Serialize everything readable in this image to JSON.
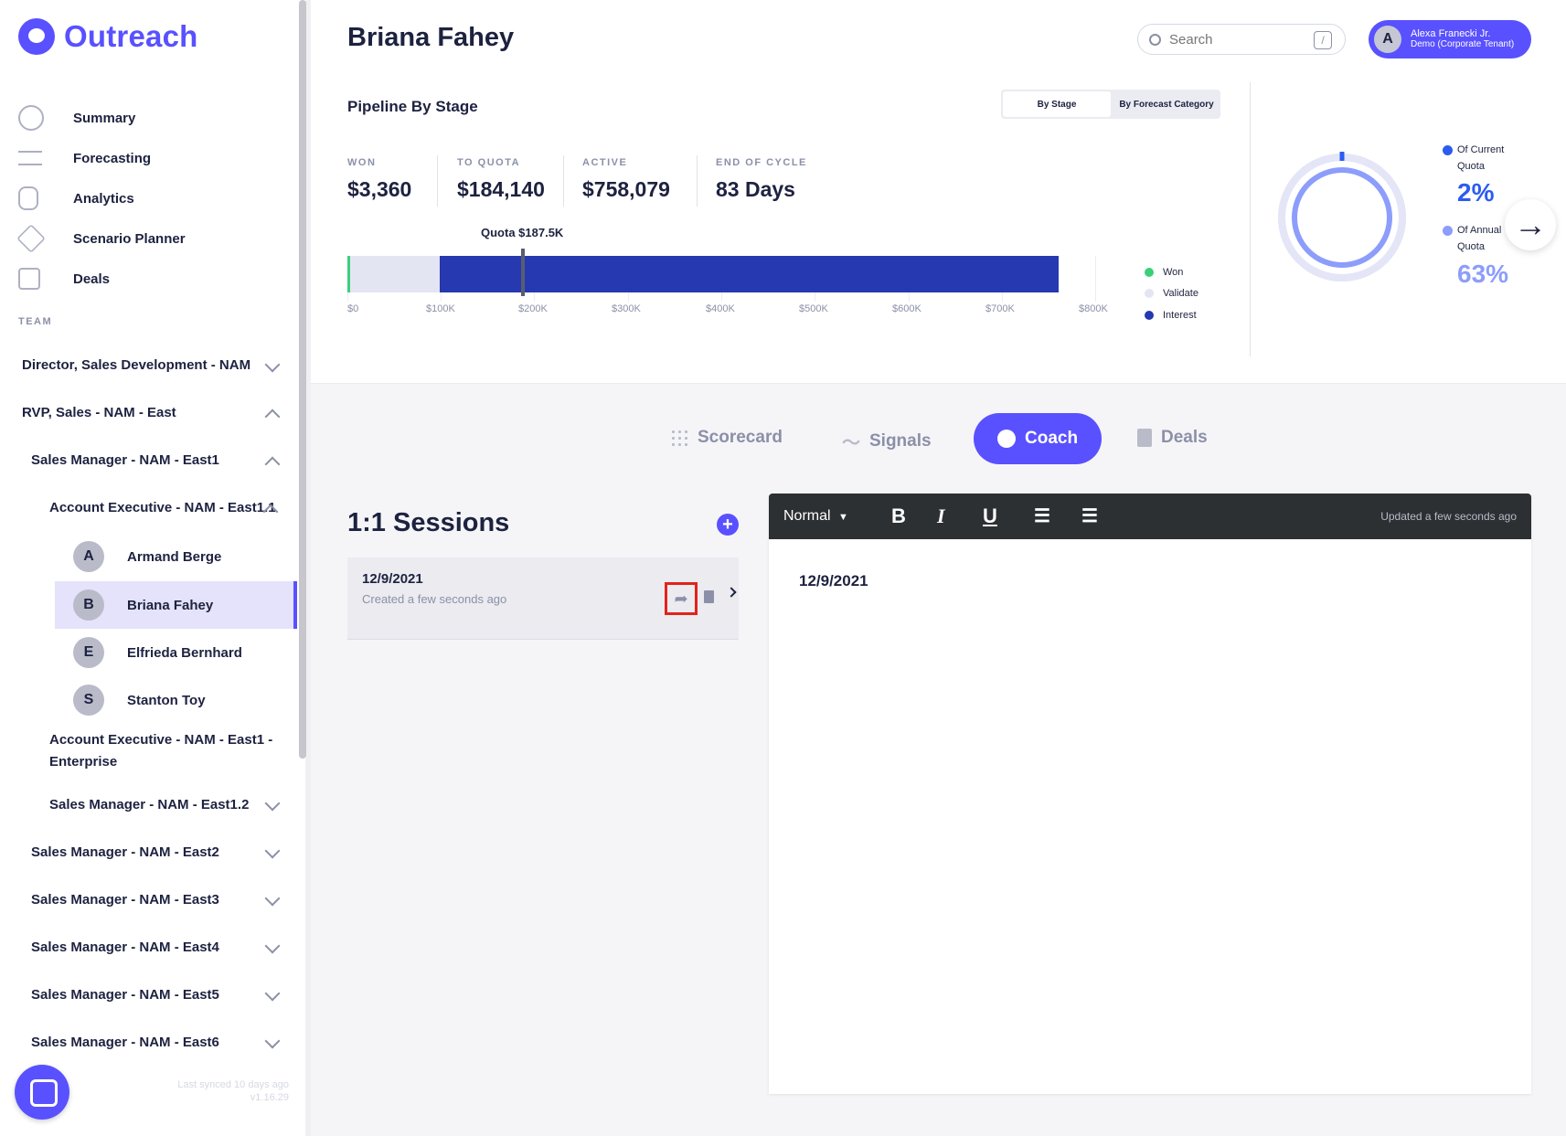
{
  "app": {
    "brand": "Outreach",
    "accent": "#5951ff"
  },
  "sidebar": {
    "nav": [
      {
        "label": "Summary",
        "icon": "circle-icon"
      },
      {
        "label": "Forecasting",
        "icon": "lines-icon"
      },
      {
        "label": "Analytics",
        "icon": "analytics-icon"
      },
      {
        "label": "Scenario Planner",
        "icon": "triangle-icon"
      },
      {
        "label": "Deals",
        "icon": "squares-icon"
      }
    ],
    "team_title": "TEAM",
    "tree": [
      {
        "label": "Director, Sales Development - NAM",
        "state": "collapsed"
      },
      {
        "label": "RVP, Sales - NAM - East",
        "state": "expanded"
      },
      {
        "label": "Sales Manager - NAM - East1",
        "state": "expanded"
      },
      {
        "label": "Account Executive - NAM - East1.1",
        "state": "expanded"
      }
    ],
    "people": [
      {
        "initial": "A",
        "name": "Armand Berge"
      },
      {
        "initial": "B",
        "name": "Briana Fahey"
      },
      {
        "initial": "E",
        "name": "Elfrieda Bernhard"
      },
      {
        "initial": "S",
        "name": "Stanton Toy"
      }
    ],
    "tree_more": [
      {
        "label": "Account Executive - NAM - East1 -"
      },
      {
        "label": "Enterprise"
      },
      {
        "label": "Sales Manager - NAM - East1.2"
      },
      {
        "label": "Sales Manager - NAM - East2"
      },
      {
        "label": "Sales Manager - NAM - East3"
      },
      {
        "label": "Sales Manager - NAM - East4"
      },
      {
        "label": "Sales Manager - NAM - East5"
      },
      {
        "label": "Sales Manager - NAM - East6"
      }
    ],
    "sync": "Last synced 10 days ago",
    "version": "v1.16.29"
  },
  "header": {
    "title": "Briana Fahey",
    "search_placeholder": "Search",
    "shortcut": "/",
    "user": {
      "initial": "A",
      "name": "Alexa Franecki Jr.",
      "tenant": "Demo (Corporate Tenant)"
    }
  },
  "pipeline": {
    "title": "Pipeline By Stage",
    "toggle": [
      "By Stage",
      "By Forecast Category"
    ],
    "stats": [
      {
        "label": "WON",
        "value": "$3,360"
      },
      {
        "label": "TO QUOTA",
        "value": "$184,140"
      },
      {
        "label": "ACTIVE",
        "value": "$758,079"
      },
      {
        "label": "END OF CYCLE",
        "value": "83 Days"
      }
    ],
    "quota_label": "Quota $187.5K",
    "ticks": [
      "$0",
      "$100K",
      "$200K",
      "$300K",
      "$400K",
      "$500K",
      "$600K",
      "$700K",
      "$800K"
    ],
    "legend": [
      {
        "label": "Won",
        "color": "#3ad07a"
      },
      {
        "label": "Validate",
        "color": "#e4e5f3"
      },
      {
        "label": "Interest",
        "color": "#2639b0"
      }
    ],
    "quota_ring": {
      "current_label_1": "Of Current",
      "current_label_2": "Quota",
      "current_value": "2%",
      "annual_label_1": "Of Annual",
      "annual_label_2": "Quota",
      "annual_value": "63%"
    }
  },
  "tabs": {
    "scorecard": "Scorecard",
    "signals": "Signals",
    "coach": "Coach",
    "deals": "Deals"
  },
  "sessions": {
    "title": "1:1 Sessions",
    "add": "+",
    "items": [
      {
        "date": "12/9/2021",
        "created": "Created a few seconds ago"
      }
    ]
  },
  "editor": {
    "format": "Normal",
    "updated": "Updated a few seconds ago",
    "content": "12/9/2021"
  }
}
